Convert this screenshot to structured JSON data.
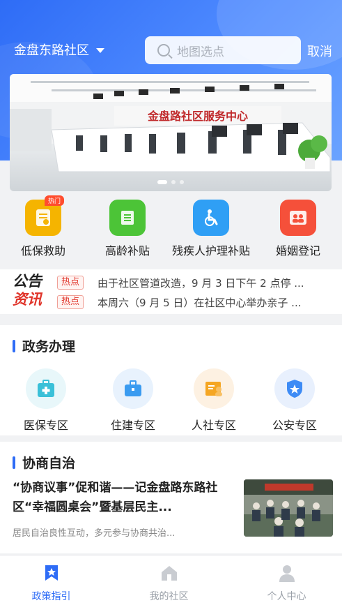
{
  "header": {
    "location": "金盘东路社区",
    "search_placeholder": "地图选点",
    "cancel_label": "取消"
  },
  "banner": {
    "sign_text": "金盘路社区服务中心",
    "slide_count": 3,
    "active_slide": 1
  },
  "quick_services": [
    {
      "label": "低保救助",
      "icon": "document-icon",
      "color": "#f5b400",
      "badge": "热门"
    },
    {
      "label": "高龄补贴",
      "icon": "book-icon",
      "color": "#4cc437"
    },
    {
      "label": "残疾人护理补贴",
      "icon": "wheelchair-icon",
      "color": "#2f9ff5"
    },
    {
      "label": "婚姻登记",
      "icon": "couple-icon",
      "color": "#f5503a"
    }
  ],
  "notice": {
    "logo_line1": "公告",
    "logo_line2": "资讯",
    "items": [
      {
        "tag": "热点",
        "text": "由于社区管道改造，9 月 3 日下午 2 点停 ..."
      },
      {
        "tag": "热点",
        "text": "本周六（9 月 5 日）在社区中心举办亲子 ..."
      }
    ]
  },
  "gov": {
    "title": "政务办理",
    "items": [
      {
        "label": "医保专区",
        "icon": "medical-kit-icon",
        "color": "#3ac0d8",
        "bg": "#e8f7fa"
      },
      {
        "label": "住建专区",
        "icon": "briefcase-icon",
        "color": "#3a9bf0",
        "bg": "#e8f2fd"
      },
      {
        "label": "人社专区",
        "icon": "id-card-icon",
        "color": "#f5a623",
        "bg": "#fdf1e2"
      },
      {
        "label": "公安专区",
        "icon": "police-badge-icon",
        "color": "#3d8bf5",
        "bg": "#e8f0fd"
      }
    ]
  },
  "consult": {
    "title": "协商自治",
    "article_title": "“协商议事”促和谐——记金盘路东路社区“幸福圆桌会”暨基层民主...",
    "article_sub": "居民自治良性互动，多元参与协商共治..."
  },
  "tabs": [
    {
      "label": "政策指引",
      "icon": "policy-bookmark-icon",
      "active": true
    },
    {
      "label": "我的社区",
      "icon": "home-icon",
      "active": false
    },
    {
      "label": "个人中心",
      "icon": "user-icon",
      "active": false
    }
  ]
}
